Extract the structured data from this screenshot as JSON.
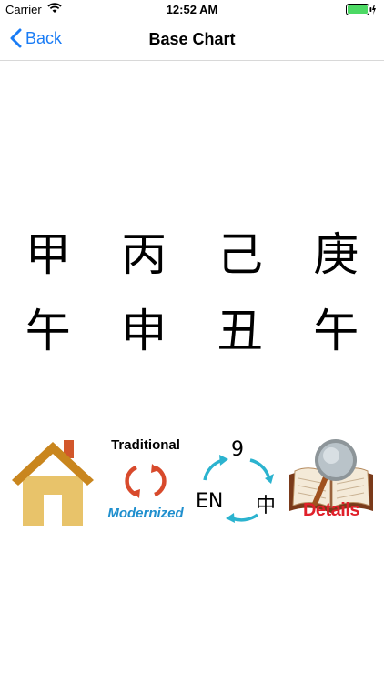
{
  "status_bar": {
    "carrier": "Carrier",
    "time": "12:52 AM",
    "battery_color": "#4cd964"
  },
  "nav": {
    "back_label": "Back",
    "title": "Base Chart",
    "tint": "#1a7cf5"
  },
  "chart": {
    "heavenly_stems": [
      "甲",
      "丙",
      "己",
      "庚"
    ],
    "earthly_branches": [
      "午",
      "申",
      "丑",
      "午"
    ]
  },
  "toolbar": {
    "home_icon": "house-icon",
    "convert": {
      "top_label": "Traditional",
      "bottom_label": "Modernized",
      "icon": "cycle-arrows-icon"
    },
    "language": {
      "number": "9",
      "left_label": "EN",
      "right_label": "中",
      "icon": "language-cycle-icon"
    },
    "details": {
      "label": "Details",
      "icon": "book-magnifier-icon"
    }
  }
}
